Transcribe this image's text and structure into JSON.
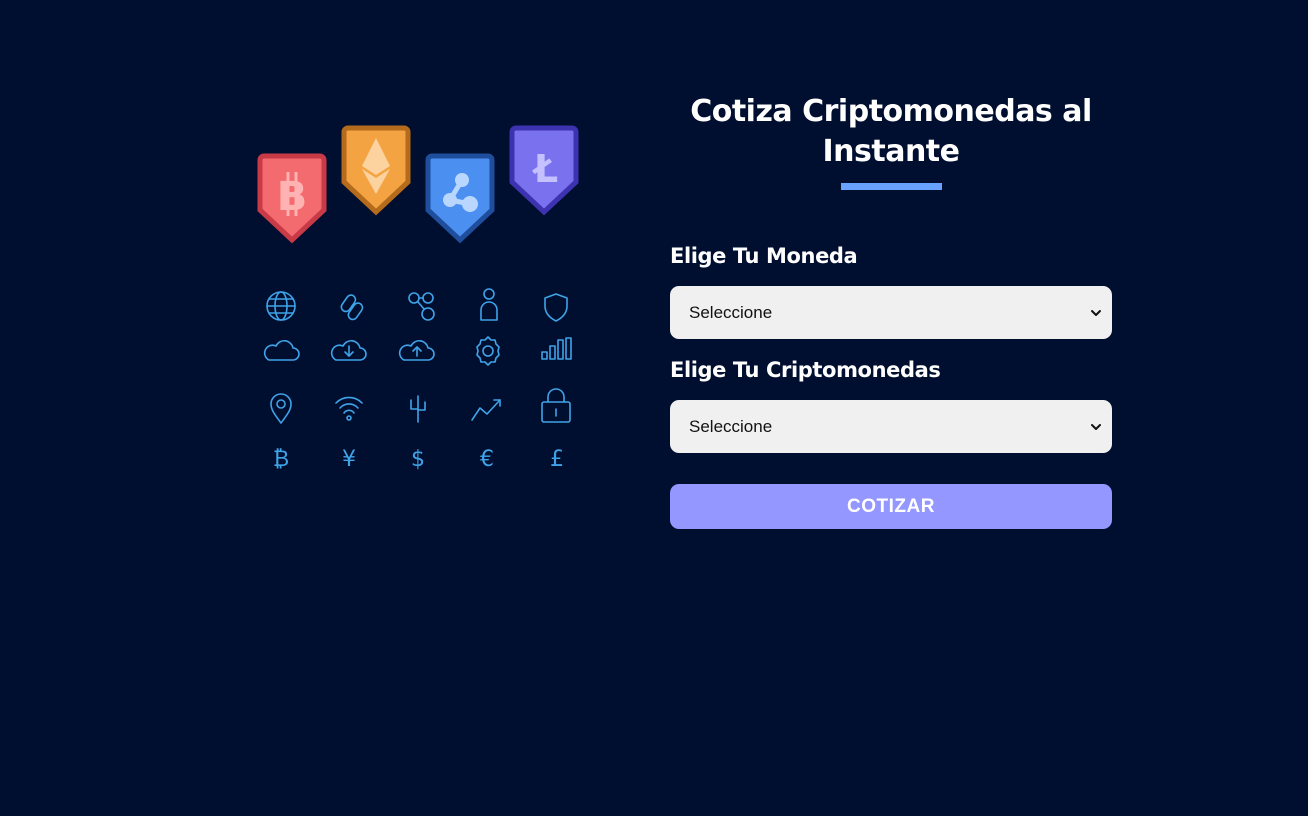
{
  "header": {
    "title": "Cotiza Criptomonedas al Instante"
  },
  "form": {
    "moneda_label": "Elige Tu Moneda",
    "moneda_selected": "Seleccione",
    "cripto_label": "Elige Tu Criptomonedas",
    "cripto_selected": "Seleccione",
    "submit_label": "COTIZAR"
  },
  "illustration": {
    "badges": [
      {
        "icon": "bitcoin-icon",
        "glyph": "B",
        "color": "#f36b6f",
        "border": "#c83a46"
      },
      {
        "icon": "ethereum-icon",
        "glyph": "",
        "color": "#f4a343",
        "border": "#b56b1c"
      },
      {
        "icon": "ripple-icon",
        "glyph": "",
        "color": "#4b8ff0",
        "border": "#1f4e9c"
      },
      {
        "icon": "litecoin-icon",
        "glyph": "Ł",
        "color": "#7a71ef",
        "border": "#3d33b0"
      }
    ],
    "icon_grid": [
      [
        "globe-icon",
        "link-icon",
        "network-icon",
        "user-icon",
        "shield-icon"
      ],
      [
        "cloud-icon",
        "cloud-download-icon",
        "cloud-upload-icon",
        "gear-icon",
        "signal-bars-icon"
      ],
      [
        "location-pin-icon",
        "wifi-icon",
        "usb-icon",
        "trend-up-icon",
        "lock-icon"
      ],
      [
        "bitcoin-symbol-icon",
        "yen-symbol-icon",
        "dollar-symbol-icon",
        "euro-symbol-icon",
        "pound-symbol-icon"
      ]
    ],
    "currency_glyphs": [
      "₿",
      "¥",
      "$",
      "€",
      "£"
    ]
  },
  "colors": {
    "background": "#000f30",
    "accent_underline": "#66a2fe",
    "button": "#9497ff",
    "icon_line": "#3fa3e8"
  }
}
